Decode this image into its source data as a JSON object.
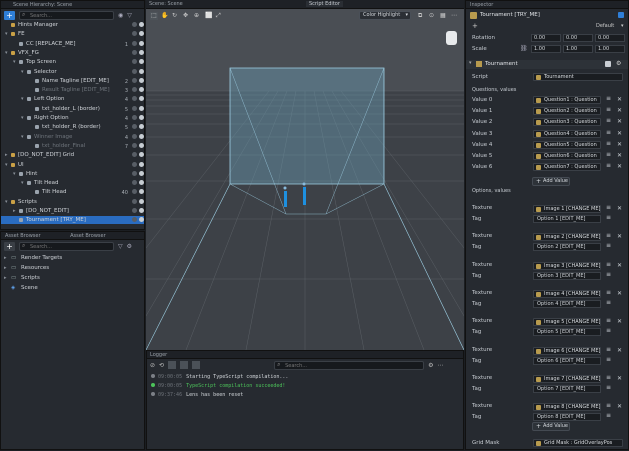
{
  "hierarchy": {
    "title": "Scene Hierarchy: Scene",
    "search_placeholder": "Search...",
    "rows": [
      {
        "label": "Hints Manager",
        "indent": 0,
        "arrow": "",
        "count": ""
      },
      {
        "label": "FE",
        "indent": 0,
        "arrow": "▾",
        "count": ""
      },
      {
        "label": "CC [REPLACE_ME]",
        "indent": 1,
        "arrow": "",
        "count": "1"
      },
      {
        "label": "VFX_FG",
        "indent": 0,
        "arrow": "▾",
        "count": ""
      },
      {
        "label": "Top Screen",
        "indent": 1,
        "arrow": "▾",
        "count": ""
      },
      {
        "label": "Selector",
        "indent": 2,
        "arrow": "▾",
        "count": ""
      },
      {
        "label": "Name Tagline [EDIT_ME]",
        "indent": 3,
        "arrow": "",
        "count": "2"
      },
      {
        "label": "Result Tagline [EDIT_ME]",
        "indent": 3,
        "arrow": "",
        "count": "3"
      },
      {
        "label": "Left Option",
        "indent": 2,
        "arrow": "▾",
        "count": "4"
      },
      {
        "label": "txt_holder_L (border)",
        "indent": 3,
        "arrow": "",
        "count": "5"
      },
      {
        "label": "Right Option",
        "indent": 2,
        "arrow": "▾",
        "count": "4"
      },
      {
        "label": "txt_holder_R (border)",
        "indent": 3,
        "arrow": "",
        "count": "5"
      },
      {
        "label": "Winner Image",
        "indent": 2,
        "arrow": "▾",
        "count": "4"
      },
      {
        "label": "txt_holder_Final",
        "indent": 3,
        "arrow": "",
        "count": "7"
      },
      {
        "label": "[DO_NOT_EDIT] Grid",
        "indent": 0,
        "arrow": "▸",
        "count": ""
      },
      {
        "label": "UI",
        "indent": 0,
        "arrow": "▾",
        "count": ""
      },
      {
        "label": "Hint",
        "indent": 1,
        "arrow": "▾",
        "count": ""
      },
      {
        "label": "Tilt Head",
        "indent": 2,
        "arrow": "▾",
        "count": ""
      },
      {
        "label": "Tilt Head",
        "indent": 3,
        "arrow": "",
        "count": "40"
      },
      {
        "label": "Scripts",
        "indent": 0,
        "arrow": "▾",
        "count": ""
      },
      {
        "label": "[DO_NOT_EDIT]",
        "indent": 1,
        "arrow": "▸",
        "count": ""
      },
      {
        "label": "Tournament [TRY_ME]",
        "indent": 1,
        "arrow": "",
        "count": ""
      }
    ]
  },
  "assets": {
    "tab1": "Asset Browser",
    "tab2": "Asset Browser",
    "search_placeholder": "Search...",
    "items": [
      "Render Targets",
      "Resources",
      "Scripts",
      "Scene"
    ]
  },
  "viewport": {
    "title": "Scene: Scene",
    "mode": "Color Highlight"
  },
  "script_editor": {
    "title": "Script Editor"
  },
  "logger": {
    "title": "Logger",
    "search_placeholder": "Search...",
    "lines": [
      {
        "time": "09:00:05",
        "text": "Starting TypeScript compilation...",
        "color": "#7c8087"
      },
      {
        "time": "09:00:05",
        "text": "TypeScript compilation succeeded!",
        "color": "#4cc35a"
      },
      {
        "time": "09:37:46",
        "text": "Lens has been reset",
        "color": "#7c8087"
      }
    ]
  },
  "inspector": {
    "title": "Inspector",
    "object": "Tournament [TRY_ME]",
    "layer": "Default",
    "rotation_label": "Rotation",
    "rotation": [
      "0.00",
      "0.00",
      "0.00"
    ],
    "scale_label": "Scale",
    "scale": [
      "1.00",
      "1.00",
      "1.00"
    ],
    "component": "Tournament",
    "script_label": "Script",
    "script_value": "Tournament",
    "questions_label": "Questions, values",
    "values": [
      {
        "label": "Value 0",
        "v": "Question1 : Question"
      },
      {
        "label": "Value 1",
        "v": "Question2 : Question"
      },
      {
        "label": "Value 2",
        "v": "Question3 : Question"
      },
      {
        "label": "Value 3",
        "v": "Question4 : Question"
      },
      {
        "label": "Value 4",
        "v": "Question5 : Question"
      },
      {
        "label": "Value 5",
        "v": "Question6 : Question"
      },
      {
        "label": "Value 6",
        "v": "Question7 : Question"
      }
    ],
    "add_value": "Add Value",
    "options_label": "Options, values",
    "options": [
      {
        "texture": "Image 1 [CHANGE ME]",
        "tag": "Option 1 [EDIT_ME]"
      },
      {
        "texture": "Image 2 [CHANGE ME]",
        "tag": "Option 2 [EDIT_ME]"
      },
      {
        "texture": "Image 3 [CHANGE ME]",
        "tag": "Option 3 [EDIT_ME]"
      },
      {
        "texture": "Image 4 [CHANGE ME]",
        "tag": "Option 4 [EDIT_ME]"
      },
      {
        "texture": "Image 5 [CHANGE ME]",
        "tag": "Option 5 [EDIT_ME]"
      },
      {
        "texture": "Image 6 [CHANGE ME]",
        "tag": "Option 6 [EDIT_ME]"
      },
      {
        "texture": "Image 7 [CHANGE ME]",
        "tag": "Option 7 [EDIT_ME]"
      },
      {
        "texture": "Image 8 [CHANGE ME]",
        "tag": "Option 8 [EDIT_ME]"
      }
    ],
    "texture_label": "Texture",
    "tag_label": "Tag",
    "add_value2": "Add Value",
    "grid_label": "Grid Mask",
    "grid_value": "Grid Mask : GridOverlayPos"
  },
  "colors": {
    "accent": "#2f7fd8",
    "selected": "#2a6cc0",
    "success": "#4cc35a"
  }
}
